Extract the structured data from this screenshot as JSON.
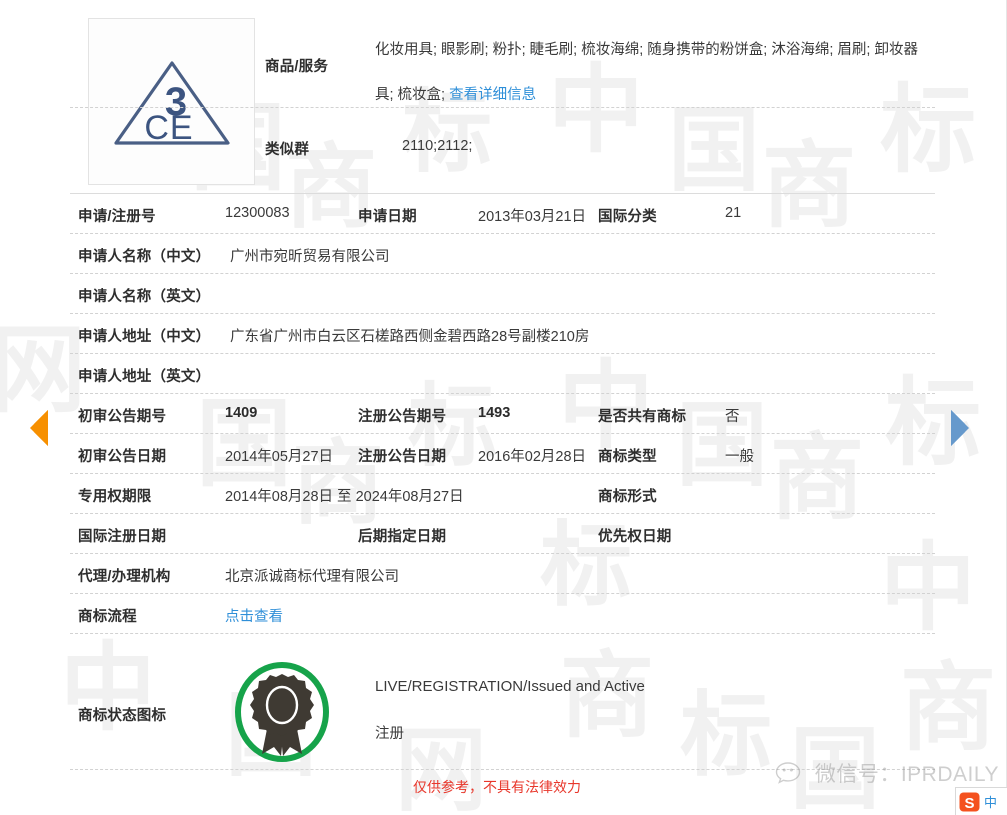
{
  "record": {
    "goods_services": {
      "label": "商品/服务",
      "value": "化妆用具; 眼影刷; 粉扑; 睫毛刷; 梳妆海绵; 随身携带的粉饼盒; 沐浴海绵; 眉刷; 卸妆器具; 梳妆盒;",
      "detail_link": "查看详细信息"
    },
    "similar_group": {
      "label": "类似群",
      "value": "2110;2112;"
    },
    "application_number": {
      "label": "申请/注册号",
      "value": "12300083"
    },
    "application_date": {
      "label": "申请日期",
      "value": "2013年03月21日"
    },
    "international_class": {
      "label": "国际分类",
      "value": "21"
    },
    "applicant_name_cn": {
      "label": "申请人名称（中文）",
      "value": "广州市宛昕贸易有限公司"
    },
    "applicant_name_en": {
      "label": "申请人名称（英文）",
      "value": ""
    },
    "applicant_address_cn": {
      "label": "申请人地址（中文）",
      "value": "广东省广州市白云区石槎路西侧金碧西路28号副楼210房"
    },
    "applicant_address_en": {
      "label": "申请人地址（英文）",
      "value": ""
    },
    "prelim_announcement_issue": {
      "label": "初审公告期号",
      "value": "1409"
    },
    "registration_announcement_issue": {
      "label": "注册公告期号",
      "value": "1493"
    },
    "is_shared_mark": {
      "label": "是否共有商标",
      "value": "否"
    },
    "prelim_announcement_date": {
      "label": "初审公告日期",
      "value": "2014年05月27日"
    },
    "registration_announcement_date": {
      "label": "注册公告日期",
      "value": "2016年02月28日"
    },
    "mark_type": {
      "label": "商标类型",
      "value": "一般"
    },
    "exclusive_right_period": {
      "label": "专用权期限",
      "value": "2014年08月28日 至 2024年08月27日"
    },
    "mark_form": {
      "label": "商标形式",
      "value": ""
    },
    "international_registration_date": {
      "label": "国际注册日期",
      "value": ""
    },
    "subsequent_designation_date": {
      "label": "后期指定日期",
      "value": ""
    },
    "priority_date": {
      "label": "优先权日期",
      "value": ""
    },
    "agency": {
      "label": "代理/办理机构",
      "value": "北京派诚商标代理有限公司"
    },
    "mark_process": {
      "label": "商标流程",
      "link": "点击查看"
    },
    "status_icon": {
      "label": "商标状态图标",
      "status_en": "LIVE/REGISTRATION/Issued and Active",
      "status_cn": "注册"
    }
  },
  "mark_image": {
    "name": "3ce-triangle-logo",
    "text_top": "3",
    "text_bottom": "CE"
  },
  "footer": {
    "disclaimer": "仅供参考，不具有法律效力"
  },
  "watermark": {
    "wechat_label": "微信号：IPRDAILY",
    "background_glyphs": [
      "中",
      "国",
      "商",
      "标",
      "网"
    ]
  },
  "navigation": {
    "prev_label": "上一个",
    "next_label": "下一个"
  },
  "ime": {
    "sogou_letter": "S",
    "sogou_mode": "中"
  },
  "colors": {
    "link": "#2f8fd8",
    "disclaimer": "#e8372b",
    "status_ring": "#16a34a",
    "prev_arrow": "#f79000",
    "next_arrow": "#6699cc",
    "mark_stroke": "#4a5f85"
  }
}
